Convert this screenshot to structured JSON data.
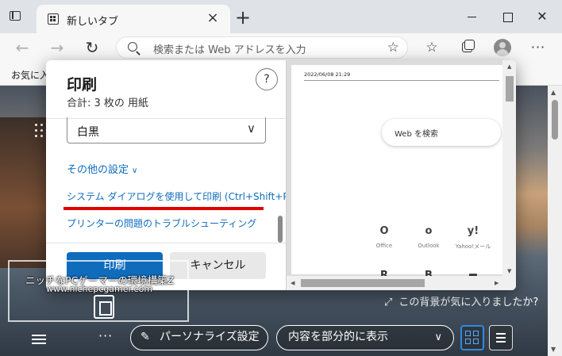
{
  "tab": {
    "title": "新しいタブ",
    "close_glyph": "×",
    "new_tab_glyph": "+"
  },
  "window": {
    "close_glyph": "✕"
  },
  "toolbar": {
    "back_glyph": "←",
    "forward_glyph": "→",
    "refresh_glyph": "↻",
    "address_placeholder": "検索または Web アドレスを入力",
    "favorite_add_glyph": "☆",
    "favorites_glyph": "☆",
    "more_glyph": "···"
  },
  "favorites_bar": {
    "label": "お気に入"
  },
  "print_dialog": {
    "title": "印刷",
    "sheets": "合計: 3 枚の 用紙",
    "help_glyph": "?",
    "color_value": "白黒",
    "chevron_glyph": "∨",
    "more_settings": "その他の設定",
    "more_chevron": "∨",
    "system_dialog_link": "システム ダイアログを使用して印刷 (Ctrl+Shift+P)",
    "troubleshoot_link": "プリンターの問題のトラブルシューティング",
    "print_button": "印刷",
    "cancel_button": "キャンセル"
  },
  "preview": {
    "date": "2022/06/08 21:29",
    "search_label": "Web を検索",
    "tiles": [
      {
        "icon": "O",
        "label": "Office"
      },
      {
        "icon": "o",
        "label": "Outlook"
      },
      {
        "icon": "y!",
        "label": "Yahoo!メール"
      }
    ],
    "tiles_row2": [
      "R",
      "B",
      "▬"
    ],
    "scroll_up": "▲",
    "scroll_down": "▼",
    "scroll_left": "◀",
    "scroll_right": "▶"
  },
  "background_page": {
    "like_text": "この背景が気に入りましたか?",
    "like_icon": "⤢",
    "dots_glyph": "···",
    "personalize_label": "パーソナライズ設定",
    "pencil_glyph": "✎",
    "content_label": "内容を部分的に表示",
    "content_chevron": "∨",
    "scroll_up": "▲",
    "scroll_down": "▼"
  },
  "watermark": {
    "title": "ニッチなPCゲーマーの環境構築Z",
    "url": "www.nichepcgamer.com"
  },
  "colors": {
    "accent": "#0f6cbd",
    "highlight_underline": "#e00000",
    "toolbar_bg": "#f7f7f7",
    "titlebar_bg": "#dfe3e8"
  }
}
